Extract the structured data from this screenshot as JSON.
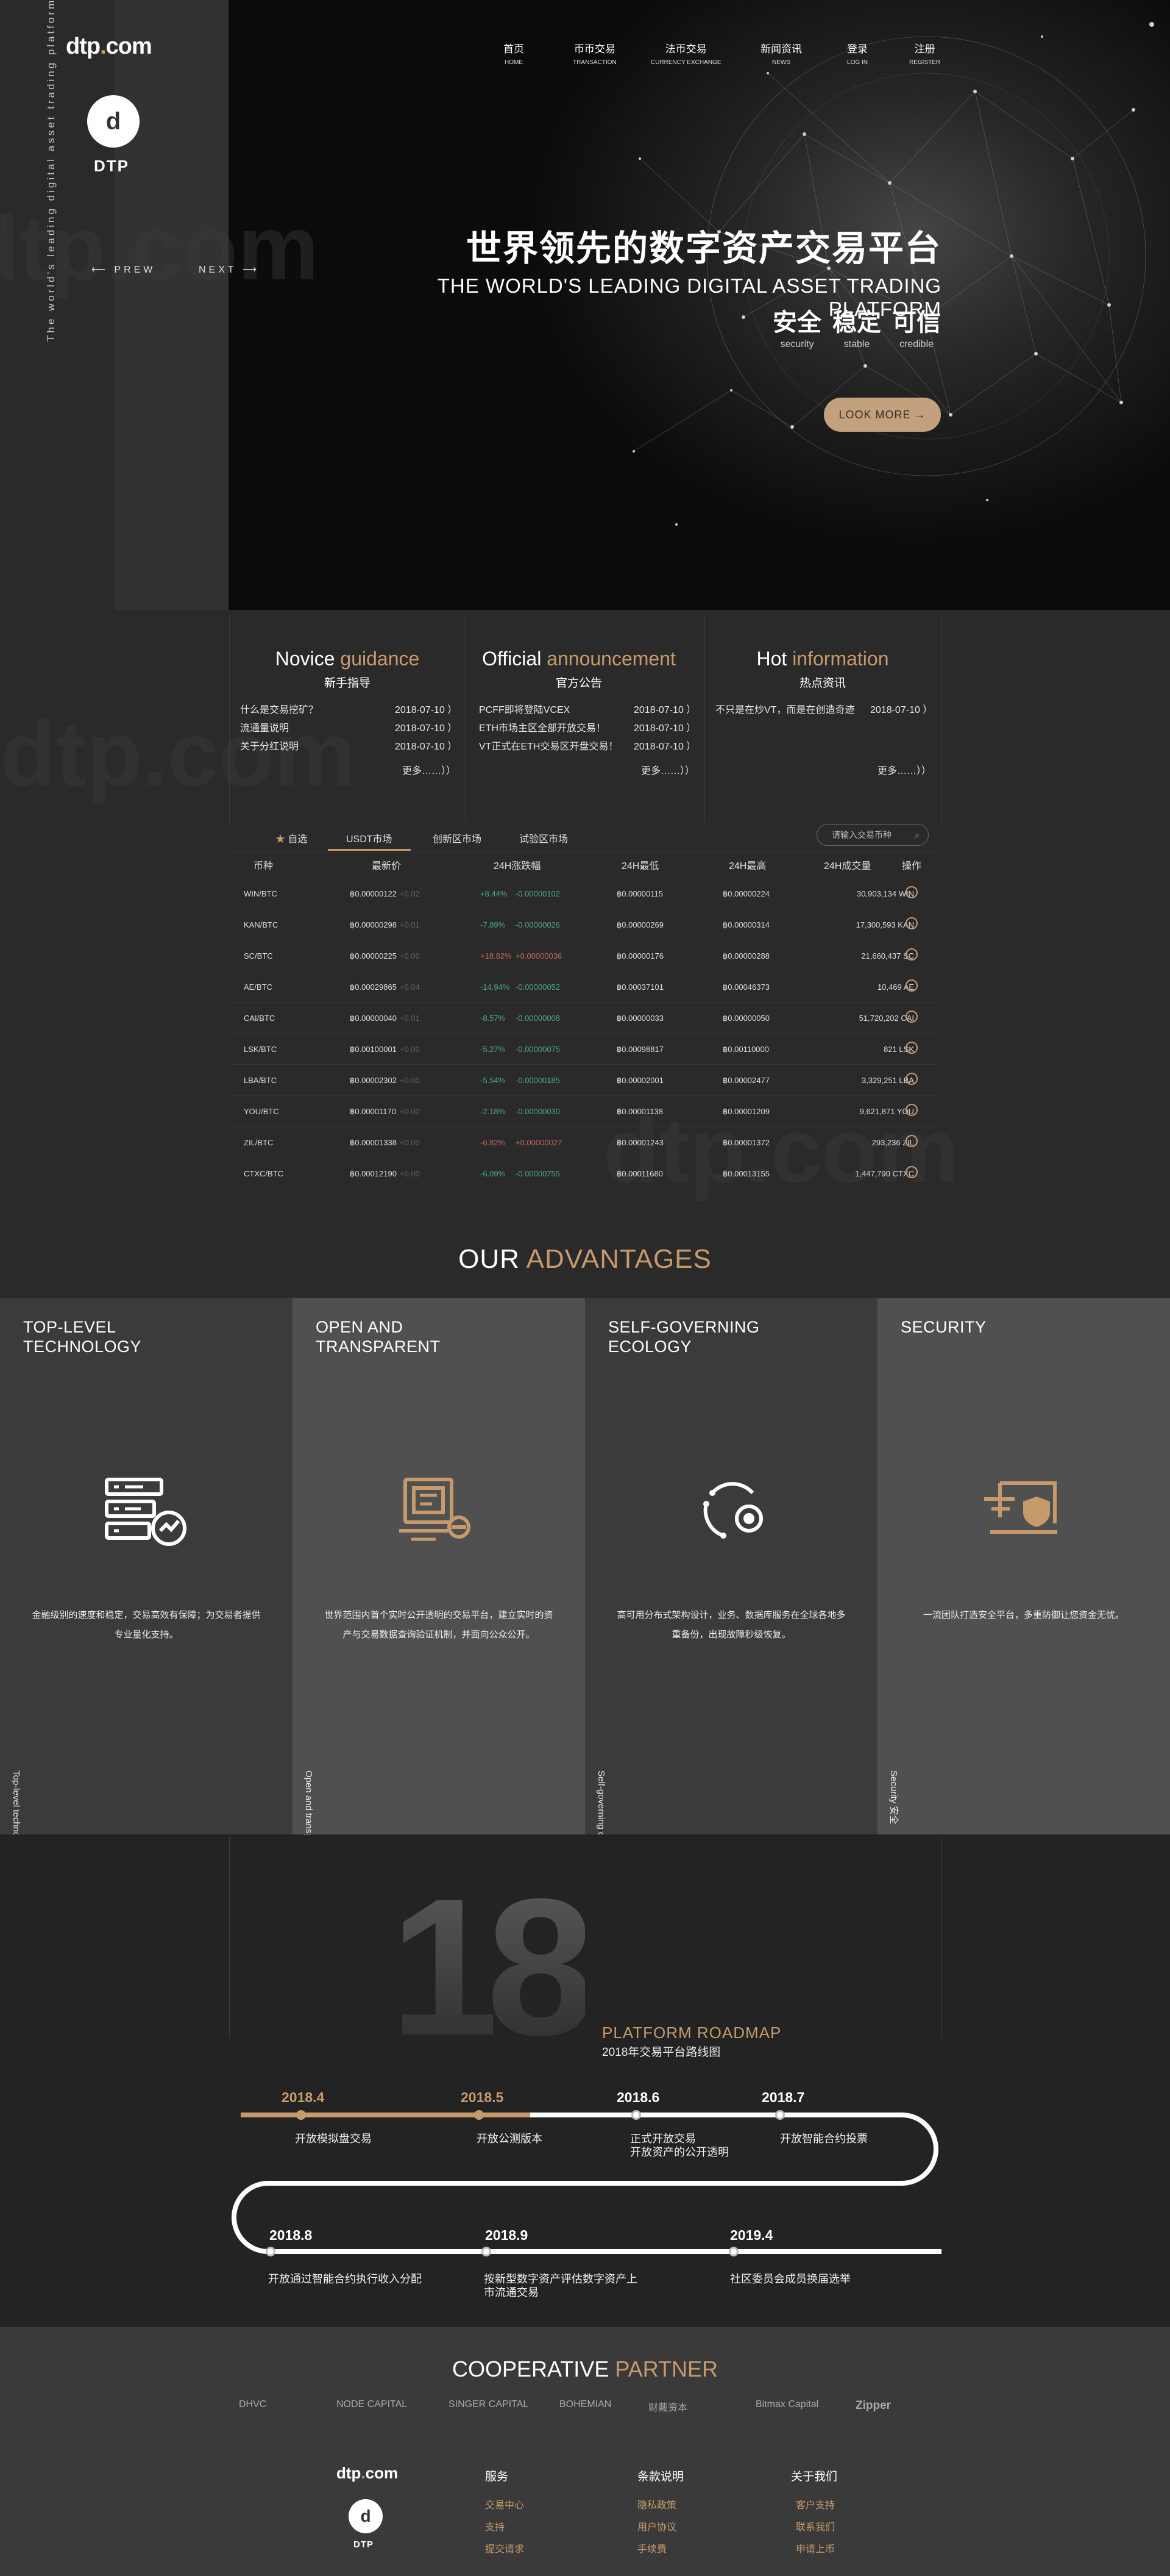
{
  "brand": {
    "logo_main": "dtp",
    "logo_dot": ".",
    "logo_tld": "com",
    "mark": "d",
    "mark_label": "DTP",
    "watermark": "dtp.com"
  },
  "hero": {
    "vertical_text": "The world's leading digital asset trading platform",
    "prev": "PREW",
    "next": "NEXT",
    "title_cn": "世界领先的数字资产交易平台",
    "title_en": "THE WORLD'S LEADING DIGITAL ASSET TRADING PLATFORM",
    "pillars": [
      {
        "cn": "安全",
        "en": "security"
      },
      {
        "cn": "稳定",
        "en": "stable"
      },
      {
        "cn": "可信",
        "en": "credible"
      }
    ],
    "cta": "LOOK MORE →"
  },
  "nav": [
    {
      "cn": "首页",
      "en": "HOME"
    },
    {
      "cn": "币币交易",
      "en": "TRANSACTION"
    },
    {
      "cn": "法币交易",
      "en": "CURRENCY EXCHANGE"
    },
    {
      "cn": "新闻资讯",
      "en": "NEWS"
    },
    {
      "cn": "登录",
      "en": "LOG IN"
    },
    {
      "cn": "注册",
      "en": "REGISTER"
    }
  ],
  "news": [
    {
      "en1": "Novice ",
      "en2": "guidance",
      "cn": "新手指导",
      "items": [
        {
          "t": "什么是交易挖矿？",
          "d": "2018-07-10 ）"
        },
        {
          "t": "流通量说明",
          "d": "2018-07-10 ）"
        },
        {
          "t": "关于分红说明",
          "d": "2018-07-10 ）"
        }
      ],
      "more": "更多……））"
    },
    {
      "en1": "Official ",
      "en2": "announcement",
      "cn": "官方公告",
      "items": [
        {
          "t": "PCFF即将登陆VCEX",
          "d": "2018-07-10 ）"
        },
        {
          "t": "ETH市场主区全部开放交易！",
          "d": "2018-07-10 ）"
        },
        {
          "t": "VT正式在ETH交易区开盘交易！",
          "d": "2018-07-10 ）"
        }
      ],
      "more": "更多……））"
    },
    {
      "en1": "Hot ",
      "en2": "information",
      "cn": "热点资讯",
      "items": [
        {
          "t": "不只是在炒VT，而是在创造奇迹",
          "d": "2018-07-10 ）"
        }
      ],
      "more": "更多……））"
    }
  ],
  "market": {
    "tabs": [
      "自选",
      "USDT市场",
      "创新区市场",
      "试验区市场"
    ],
    "search_placeholder": "请输入交易币种",
    "headers": [
      "币种",
      "最新价",
      "24H涨跌幅",
      "24H最低",
      "24H最高",
      "24H成交量",
      "操作"
    ],
    "rows": [
      [
        "WIN/BTC",
        "฿0.00000122",
        "+0.02",
        "+8.44%",
        "-0.00000102",
        "฿0.00000115",
        "฿0.00000224",
        "30,903,134 WIN",
        "g"
      ],
      [
        "KAN/BTC",
        "฿0.00000298",
        "+0.01",
        "-7.89%",
        "-0.00000026",
        "฿0.00000269",
        "฿0.00000314",
        "17,300,593 KAN",
        "g"
      ],
      [
        "SC/BTC",
        "฿0.00000225",
        "+0.00",
        "+18.82%",
        "+0.00000036",
        "฿0.00000176",
        "฿0.00000288",
        "21,660,437 SC",
        "r"
      ],
      [
        "AE/BTC",
        "฿0.00029865",
        "+0.04",
        "-14.94%",
        "-0.00000052",
        "฿0.00037101",
        "฿0.00046373",
        "10,469 AE",
        "g"
      ],
      [
        "CAI/BTC",
        "฿0.00000040",
        "+0.01",
        "-8.57%",
        "-0.00000008",
        "฿0.00000033",
        "฿0.00000050",
        "51,720,202 CAI",
        "g"
      ],
      [
        "LSK/BTC",
        "฿0.00100001",
        "+0.00",
        "-5.27%",
        "-0.00000075",
        "฿0.00098817",
        "฿0.00110000",
        "821 LSK",
        "g"
      ],
      [
        "LBA/BTC",
        "฿0.00002302",
        "+0.00",
        "-5.54%",
        "-0.00000185",
        "฿0.00002001",
        "฿0.00002477",
        "3,329,251 LBA",
        "g"
      ],
      [
        "YOU/BTC",
        "฿0.00001170",
        "+0.00",
        "-2.18%",
        "-0.00000030",
        "฿0.00001138",
        "฿0.00001209",
        "9,621,871 YOU",
        "g"
      ],
      [
        "ZIL/BTC",
        "฿0.00001338",
        "+0.00",
        "-6.82%",
        "+0.00000027",
        "฿0.00001243",
        "฿0.00001372",
        "293,236 ZIL",
        "r"
      ],
      [
        "CTXC/BTC",
        "฿0.00012190",
        "+0.00",
        "-6.09%",
        "-0.00000755",
        "฿0.00011680",
        "฿0.00013155",
        "1,447,790 CTXC",
        "g"
      ]
    ]
  },
  "advantages": {
    "t1": "OUR ",
    "t2": "ADVANTAGES",
    "cols": [
      {
        "h": "TOP-LEVEL\nTECHNOLOGY",
        "p": "金融级别的速度和稳定，交易高效有保障；为交易者提供专业量化支持。",
        "v": "Top-level technology  顶级技术",
        "icon": "server-chart-icon"
      },
      {
        "h": "OPEN AND\nTRANSPARENT",
        "p": "世界范围内首个实时公开透明的交易平台，建立实时的资产与交易数据查询验证机制，并面向公众公开。",
        "v": "Open and transparent  公开透明",
        "icon": "transparent-report-icon"
      },
      {
        "h": "SELF-GOVERNING\nECOLOGY",
        "p": "高可用分布式架构设计，业务、数据库服务在全球各地多重备份，出现故障秒级恢复。",
        "v": "Self-governing ecology  自治生态",
        "icon": "cycle-ecology-icon"
      },
      {
        "h": "SECURITY",
        "p": "一流团队打造安全平台，多重防御让您资金无忧。",
        "v": "Security  安全",
        "icon": "laptop-shield-icon"
      }
    ]
  },
  "roadmap": {
    "number": "18",
    "en": "PLATFORM ROADMAP",
    "cn": "2018年交易平台路线图",
    "items": [
      {
        "y": "2018.4",
        "e": "开放模拟盘交易"
      },
      {
        "y": "2018.5",
        "e": "开放公测版本"
      },
      {
        "y": "2018.6",
        "e": "正式开放交易\n开放资产的公开透明"
      },
      {
        "y": "2018.7",
        "e": "开放智能合约投票"
      },
      {
        "y": "2018.8",
        "e": "开放通过智能合约执行收入分配"
      },
      {
        "y": "2018.9",
        "e": "按新型数字资产评估数字资产上\n市流通交易"
      },
      {
        "y": "2019.4",
        "e": "社区委员会成员换届选举"
      }
    ]
  },
  "partners": {
    "t1": "COOPERATIVE ",
    "t2": "PARTNER",
    "list": [
      "DHVC",
      "NODE CAPITAL",
      "SINGER CAPITAL",
      "BOHEMIAN",
      "财戴资本",
      "Bitmax Capital",
      "Zipper"
    ]
  },
  "footer": {
    "logo": "dtp",
    "dot": ".",
    "tld": "com",
    "mark": "d",
    "mark_label": "DTP",
    "cols": [
      {
        "h": "服务",
        "i": [
          "交易中心",
          "支持",
          "提交请求"
        ]
      },
      {
        "h": "条款说明",
        "i": [
          "隐私政策",
          "用户协议",
          "手续费"
        ]
      },
      {
        "h": "关于我们",
        "i": [
          "客户支持",
          "联系我们",
          "申请上币"
        ]
      }
    ]
  }
}
